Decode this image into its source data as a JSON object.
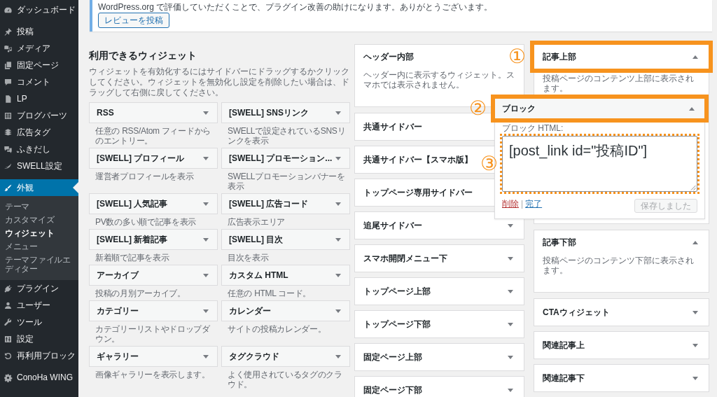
{
  "sidebar": {
    "groups": [
      {
        "items": [
          {
            "label": "ダッシュボード",
            "selected": false
          }
        ]
      },
      {
        "items": [
          {
            "label": "投稿",
            "selected": false
          },
          {
            "label": "メディア",
            "selected": false
          },
          {
            "label": "固定ページ",
            "selected": false
          },
          {
            "label": "コメント",
            "selected": false
          },
          {
            "label": "LP",
            "selected": false
          },
          {
            "label": "ブログパーツ",
            "selected": false
          },
          {
            "label": "広告タグ",
            "selected": false
          },
          {
            "label": "ふきだし",
            "selected": false
          },
          {
            "label": "SWELL設定",
            "selected": false
          }
        ]
      },
      {
        "items": [
          {
            "label": "外観",
            "selected": true,
            "children": [
              {
                "label": "テーマ",
                "selected": false
              },
              {
                "label": "カスタマイズ",
                "selected": false
              },
              {
                "label": "ウィジェット",
                "selected": true
              },
              {
                "label": "メニュー",
                "selected": false
              },
              {
                "label": "テーマファイルエディター",
                "selected": false
              }
            ]
          },
          {
            "label": "プラグイン",
            "selected": false
          },
          {
            "label": "ユーザー",
            "selected": false
          },
          {
            "label": "ツール",
            "selected": false
          },
          {
            "label": "設定",
            "selected": false
          },
          {
            "label": "再利用ブロック",
            "selected": false
          }
        ]
      },
      {
        "items": [
          {
            "label": "ConoHa WING",
            "selected": false
          }
        ]
      }
    ]
  },
  "notice": {
    "text": "WordPress.org で評価していただくことで、プラグイン改善の助けになります。ありがとうございます。",
    "button": "レビューを投稿"
  },
  "available_widgets": {
    "title": "利用できるウィジェット",
    "description": "ウィジェットを有効化するにはサイドバーにドラッグするかクリックしてください。ウィジェットを無効化し設定を削除したい場合は、ドラッグして右側に戻してください。",
    "widgets": [
      {
        "name": "RSS",
        "description": "任意の RSS/Atom フィードからのエントリー。"
      },
      {
        "name": "[SWELL] SNSリンク",
        "description": "SWELLで設定されているSNSリンクを表示"
      },
      {
        "name": "[SWELL] プロフィール",
        "description": "運営者プロフィールを表示"
      },
      {
        "name": "[SWELL] プロモーション...",
        "description": "SWELLプロモーションバナーを表示"
      },
      {
        "name": "[SWELL] 人気記事",
        "description": "PV数の多い順で記事を表示"
      },
      {
        "name": "[SWELL] 広告コード",
        "description": "広告表示エリア"
      },
      {
        "name": "[SWELL] 新着記事",
        "description": "新着順で記事を表示"
      },
      {
        "name": "[SWELL] 目次",
        "description": "目次を表示"
      },
      {
        "name": "アーカイブ",
        "description": "投稿の月別アーカイブ。"
      },
      {
        "name": "カスタム HTML",
        "description": "任意の HTML コード。"
      },
      {
        "name": "カテゴリー",
        "description": "カテゴリーリストやドロップダウン。"
      },
      {
        "name": "カレンダー",
        "description": "サイトの投稿カレンダー。"
      },
      {
        "name": "ギャラリー",
        "description": "画像ギャラリーを表示します。"
      },
      {
        "name": "タグクラウド",
        "description": "よく使用されているタグのクラウド。"
      }
    ]
  },
  "widget_areas": {
    "columns": [
      {
        "areas": [
          {
            "name": "ヘッダー内部",
            "description": "ヘッダー内に表示するウィジェット。スマホでは表示されません。",
            "expanded": true
          },
          {
            "name": "共通サイドバー",
            "expanded": false
          },
          {
            "name": "共通サイドバー【スマホ版】",
            "expanded": false
          },
          {
            "name": "トップページ専用サイドバー",
            "expanded": false
          },
          {
            "name": "追尾サイドバー",
            "expanded": false
          },
          {
            "name": "スマホ開閉メニュー下",
            "expanded": false
          },
          {
            "name": "トップページ上部",
            "expanded": false
          },
          {
            "name": "トップページ下部",
            "expanded": false
          },
          {
            "name": "固定ページ上部",
            "expanded": false
          },
          {
            "name": "固定ページ下部",
            "expanded": false
          }
        ]
      },
      {
        "areas": [
          {
            "name": "記事上部",
            "description": "投稿ページのコンテンツ上部に表示されます。",
            "expanded": true,
            "highlight": {
              "label": "①",
              "kind": "solid"
            },
            "widgets": [
              {
                "name": "ブロック",
                "expanded": true,
                "highlight": {
                  "label": "②",
                  "kind": "solid"
                },
                "field": {
                  "label": "ブロック HTML:",
                  "value": "[post_link id=\"投稿ID\"]",
                  "highlight": {
                    "label": "③",
                    "kind": "dotted"
                  }
                },
                "links": [
                  {
                    "label": "削除",
                    "kind": "delete"
                  },
                  {
                    "label": "完了",
                    "kind": "done"
                  }
                ],
                "link_separator": "|",
                "save_button": {
                  "label": "保存しました",
                  "disabled": true
                }
              }
            ]
          },
          {
            "name": "記事下部",
            "description": "投稿ページのコンテンツ下部に表示されます。",
            "expanded": true
          },
          {
            "name": "CTAウィジェット",
            "expanded": false
          },
          {
            "name": "関連記事上",
            "expanded": false
          },
          {
            "name": "関連記事下",
            "expanded": false
          }
        ]
      }
    ]
  }
}
